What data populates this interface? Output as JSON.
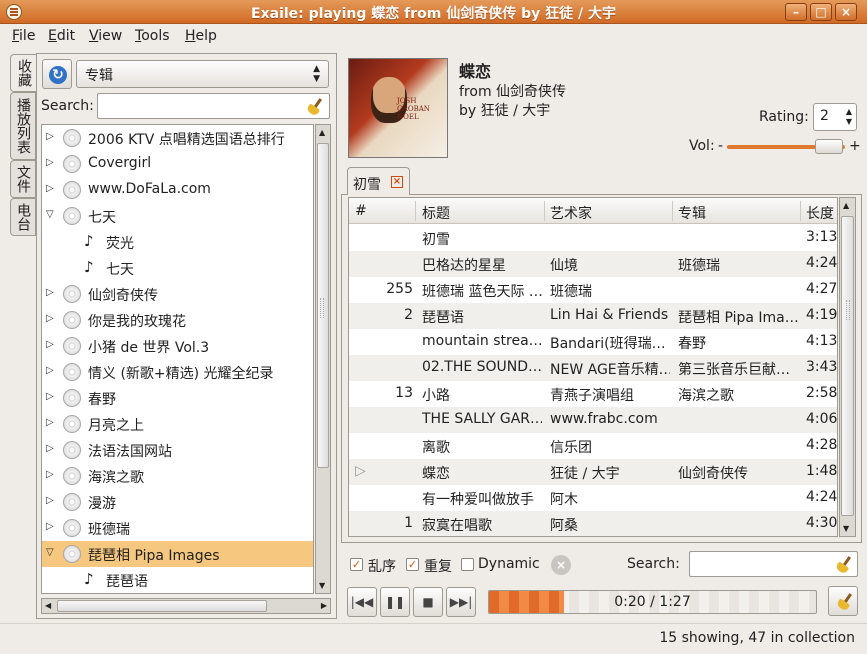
{
  "window": {
    "title": "Exaile: playing 蝶恋 from 仙剑奇侠传 by 狂徒 / 大宇"
  },
  "menu": [
    "File",
    "Edit",
    "View",
    "Tools",
    "Help"
  ],
  "sidetabs": [
    "收藏",
    "播放列表",
    "文件",
    "电台"
  ],
  "collection": {
    "view_mode": "专辑",
    "search_label": "Search:",
    "search_value": "",
    "items": [
      {
        "label": "2006 KTV 点唱精选国语总排行",
        "expander": "▷",
        "kind": "album"
      },
      {
        "label": "Covergirl",
        "expander": "▷",
        "kind": "album"
      },
      {
        "label": "www.DoFaLa.com",
        "expander": "▷",
        "kind": "album"
      },
      {
        "label": "七天",
        "expander": "▽",
        "kind": "album"
      },
      {
        "label": "荧光",
        "expander": "",
        "kind": "track"
      },
      {
        "label": "七天",
        "expander": "",
        "kind": "track"
      },
      {
        "label": "仙剑奇侠传",
        "expander": "▷",
        "kind": "album"
      },
      {
        "label": "你是我的玫瑰花",
        "expander": "▷",
        "kind": "album"
      },
      {
        "label": "小猪 de 世界 Vol.3",
        "expander": "▷",
        "kind": "album"
      },
      {
        "label": "情义 (新歌+精选) 光耀全纪录",
        "expander": "▷",
        "kind": "album"
      },
      {
        "label": "春野",
        "expander": "▷",
        "kind": "album"
      },
      {
        "label": "月亮之上",
        "expander": "▷",
        "kind": "album"
      },
      {
        "label": "法语法国网站",
        "expander": "▷",
        "kind": "album"
      },
      {
        "label": "海滨之歌",
        "expander": "▷",
        "kind": "album"
      },
      {
        "label": "漫游",
        "expander": "▷",
        "kind": "album"
      },
      {
        "label": "班德瑞",
        "expander": "▷",
        "kind": "album"
      },
      {
        "label": "琵琶相 Pipa Images",
        "expander": "▽",
        "kind": "album",
        "selected": true
      },
      {
        "label": "琵琶语",
        "expander": "",
        "kind": "track"
      }
    ]
  },
  "now_playing": {
    "title": "蝶恋",
    "from": "from 仙剑奇侠传",
    "by": "by 狂徒 / 大宇",
    "cover_text": "JOSH GROBAN NOEL",
    "rating_label": "Rating:",
    "rating_value": "2",
    "vol_label": "Vol:",
    "vol_minus": "-",
    "vol_plus": "+",
    "volume_level": 0.85
  },
  "playlist": {
    "tab_label": "初雪",
    "columns": [
      "#",
      "标题",
      "艺术家",
      "专辑",
      "长度"
    ],
    "rows": [
      {
        "num": "",
        "title": "初雪",
        "artist": "",
        "album": "",
        "length": "3:13",
        "playing": false
      },
      {
        "num": "",
        "title": "巴格达的星星",
        "artist": "仙境",
        "album": "班德瑞",
        "length": "4:24",
        "playing": false
      },
      {
        "num": "255",
        "title": "班德瑞 蓝色天际 …",
        "artist": "班德瑞",
        "album": "",
        "length": "4:27",
        "playing": false
      },
      {
        "num": "2",
        "title": "琵琶语",
        "artist": "Lin Hai & Friends",
        "album": "琵琶相 Pipa Ima…",
        "length": "4:19",
        "playing": false
      },
      {
        "num": "",
        "title": "mountain strea…",
        "artist": "Bandari(班得瑞…",
        "album": "春野",
        "length": "4:13",
        "playing": false
      },
      {
        "num": "",
        "title": "02.THE SOUND…",
        "artist": "NEW AGE音乐精…",
        "album": "第三张音乐巨献…",
        "length": "3:43",
        "playing": false
      },
      {
        "num": "13",
        "title": "小路",
        "artist": "青燕子演唱组",
        "album": "海滨之歌",
        "length": "2:58",
        "playing": false
      },
      {
        "num": "",
        "title": "THE SALLY GAR…",
        "artist": "www.frabc.com",
        "album": "",
        "length": "4:06",
        "playing": false
      },
      {
        "num": "",
        "title": "离歌",
        "artist": "信乐团",
        "album": "",
        "length": "4:28",
        "playing": false
      },
      {
        "num": "",
        "title": "蝶恋",
        "artist": "狂徒 / 大宇",
        "album": "仙剑奇侠传",
        "length": "1:48",
        "playing": true
      },
      {
        "num": "",
        "title": "有一种爱叫做放手",
        "artist": "阿木",
        "album": "",
        "length": "4:24",
        "playing": false
      },
      {
        "num": "1",
        "title": "寂寞在唱歌",
        "artist": "阿桑",
        "album": "",
        "length": "4:30",
        "playing": false
      }
    ]
  },
  "options": {
    "shuffle_label": "乱序",
    "repeat_label": "重复",
    "dynamic_label": "Dynamic",
    "shuffle_checked": true,
    "repeat_checked": true,
    "dynamic_checked": false,
    "search_label": "Search:",
    "search_value": ""
  },
  "transport": {
    "time": "0:20 / 1:27",
    "progress": 0.23
  },
  "status": "15 showing, 47 in collection",
  "colors": {
    "accent": "#d8692a",
    "selection": "#f5c77f"
  }
}
